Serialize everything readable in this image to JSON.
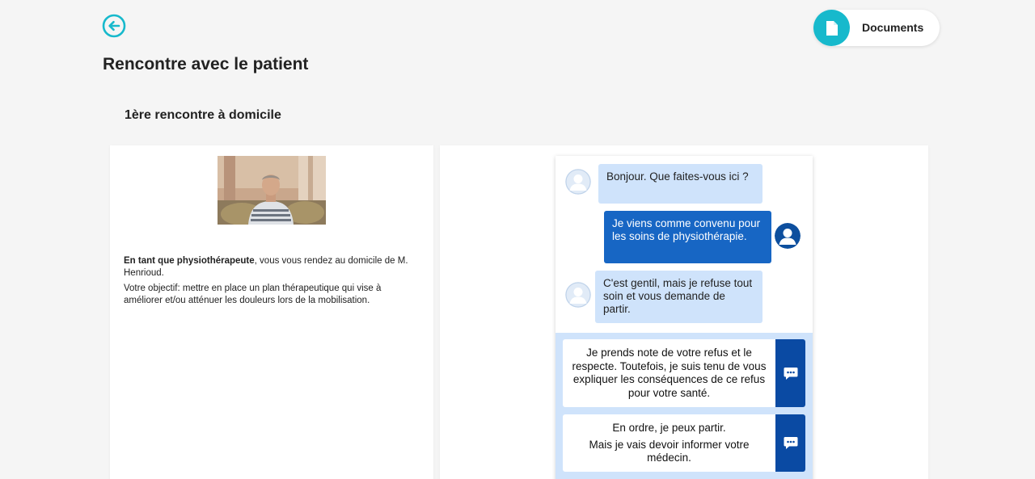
{
  "header": {
    "back_icon": "arrow-left-circle-icon",
    "documents_icon": "document-icon",
    "documents_label": "Documents",
    "accent_color": "#17b9cc"
  },
  "page_title": "Rencontre avec le patient",
  "section_title": "1ère rencontre à domicile",
  "intro": {
    "photo_alt": "patient-photo",
    "role_bold": "En tant que physiothérapeute",
    "role_rest": ", vous vous rendez au domicile de M. Henrioud.",
    "objective": "Votre objectif: mettre en place un plan thérapeutique qui vise à améliorer et/ou atténuer les douleurs lors de la mobilisation."
  },
  "chat": {
    "messages": [
      {
        "from": "patient",
        "text": "Bonjour. Que faites-vous ici ?"
      },
      {
        "from": "user",
        "text": "Je viens comme convenu pour les soins de physiothérapie."
      },
      {
        "from": "patient",
        "text": "C'est gentil, mais je refuse tout soin et vous demande de partir."
      }
    ],
    "options": [
      {
        "text": "Je prends note de votre refus et le respecte. Toutefois, je suis tenu de vous expliquer les conséquences de ce refus pour votre santé.",
        "icon": "chat-bubble-icon"
      },
      {
        "line1": "En ordre, je peux partir.",
        "line2": "Mais je vais devoir informer votre médecin.",
        "icon": "chat-bubble-icon"
      }
    ],
    "colors": {
      "incoming": "#cfe3fb",
      "outgoing": "#1766c4",
      "option_action": "#0a4aa3"
    }
  }
}
